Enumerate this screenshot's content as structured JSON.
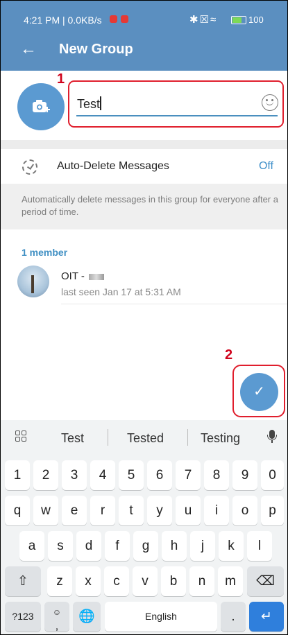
{
  "status_bar": {
    "time": "4:21 PM | 0.0KB/s",
    "battery": "100"
  },
  "header": {
    "title": "New Group"
  },
  "group_name": {
    "value": "Test"
  },
  "annotations": {
    "callout_1": "1",
    "callout_2": "2"
  },
  "auto_delete": {
    "label": "Auto-Delete Messages",
    "value": "Off",
    "description": "Automatically delete messages in this group for everyone after a period of time."
  },
  "members": {
    "heading": "1 member",
    "list": [
      {
        "name": "OIT -",
        "status": "last seen Jan 17 at 5:31 AM"
      }
    ]
  },
  "keyboard": {
    "suggestions": [
      "Test",
      "Tested",
      "Testing"
    ],
    "row_numbers": [
      "1",
      "2",
      "3",
      "4",
      "5",
      "6",
      "7",
      "8",
      "9",
      "0"
    ],
    "row_q": [
      "q",
      "w",
      "e",
      "r",
      "t",
      "y",
      "u",
      "i",
      "o",
      "p"
    ],
    "row_a": [
      "a",
      "s",
      "d",
      "f",
      "g",
      "h",
      "j",
      "k",
      "l"
    ],
    "row_z": [
      "z",
      "x",
      "c",
      "v",
      "b",
      "n",
      "m"
    ],
    "symbols_label": "?123",
    "space_label": "English",
    "period_label": ".",
    "comma_label": ","
  },
  "colors": {
    "header_bg": "#5b8fc0",
    "accent": "#3e8fc9",
    "fab": "#5b9ad1",
    "annotation_red": "#e01e2d",
    "enter_key": "#2f7fdc"
  }
}
